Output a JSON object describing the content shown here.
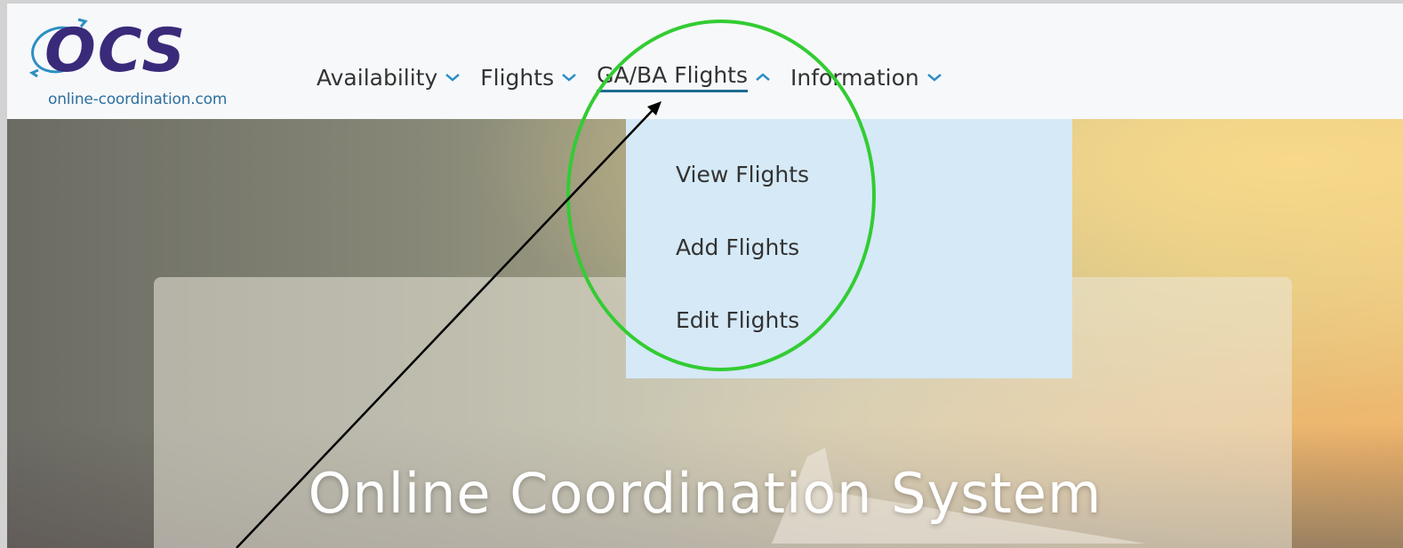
{
  "logo": {
    "wordmark": "OCS",
    "domain": "online-coordination.com"
  },
  "nav": {
    "items": [
      {
        "label": "Availability",
        "expanded": false
      },
      {
        "label": "Flights",
        "expanded": false
      },
      {
        "label": "GA/BA Flights",
        "expanded": true
      },
      {
        "label": "Information",
        "expanded": false
      }
    ]
  },
  "dropdown": {
    "items": [
      "View Flights",
      "Add Flights",
      "Edit Flights"
    ]
  },
  "hero": {
    "title": "Online Coordination System"
  },
  "colors": {
    "brand_purple": "#3a2a7a",
    "brand_blue": "#2e8fc4",
    "chevron": "#2e8fc4",
    "dropdown_bg": "#d5e9f6",
    "annotation_circle": "#33cc33",
    "annotation_arrow": "#000000"
  },
  "icons": [
    "chevron-down-icon",
    "chevron-up-icon",
    "ocs-logo"
  ]
}
